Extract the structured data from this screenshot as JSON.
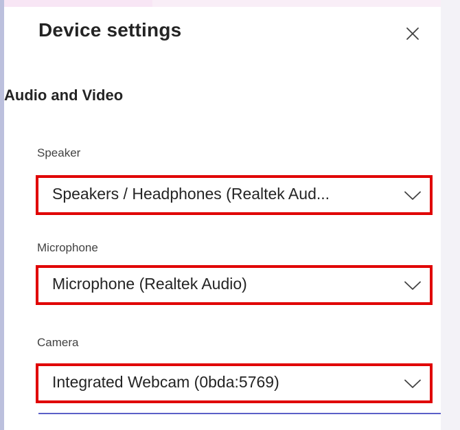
{
  "dialog": {
    "title": "Device settings",
    "close_icon": "close-icon"
  },
  "section": {
    "heading": "Audio and Video"
  },
  "speaker": {
    "label": "Speaker",
    "value": "Speakers / Headphones (Realtek Aud...",
    "icon": "chevron-down-icon"
  },
  "microphone": {
    "label": "Microphone",
    "value": "Microphone (Realtek Audio)",
    "icon": "chevron-down-icon"
  },
  "camera": {
    "label": "Camera",
    "value": "Integrated Webcam (0bda:5769)",
    "icon": "chevron-down-icon"
  },
  "colors": {
    "highlight": "#e00000",
    "accent": "#5b5fc7"
  }
}
